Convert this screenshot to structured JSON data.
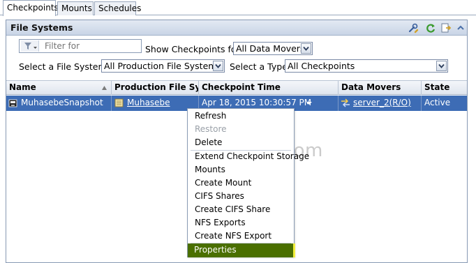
{
  "tabs": [
    "Checkpoints",
    "Mounts",
    "Schedules"
  ],
  "active_tab": "Checkpoints",
  "panel": {
    "title": "File Systems"
  },
  "header_icons": [
    "wrench-icon",
    "refresh-icon",
    "export-icon",
    "collapse-icon"
  ],
  "filter": {
    "placeholder": "Filter for",
    "value": ""
  },
  "show_checkpoints": {
    "label": "Show Checkpoints for",
    "value": "All Data Movers"
  },
  "file_system": {
    "label": "Select a File System",
    "value": "All Production File Systems"
  },
  "type": {
    "label": "Select a Type",
    "value": "All Checkpoints"
  },
  "columns": [
    "Name",
    "Production File Syst...",
    "Checkpoint Time",
    "Data Movers",
    "State"
  ],
  "rows": [
    {
      "name": "MuhasebeSnapshot",
      "production_fs": "Muhasebe",
      "checkpoint_time": "Apr 18, 2015 10:30:57 PM",
      "data_movers": "server_2(R/O)",
      "state": "Active"
    }
  ],
  "context_menu": {
    "items": [
      {
        "label": "Refresh",
        "disabled": false
      },
      {
        "label": "Restore",
        "disabled": true
      },
      {
        "label": "Delete",
        "disabled": false
      },
      {
        "label": "Extend Checkpoint Storage",
        "disabled": false
      },
      {
        "label": "Mounts",
        "disabled": false
      },
      {
        "label": "Create Mount",
        "disabled": false
      },
      {
        "label": "CIFS Shares",
        "disabled": false
      },
      {
        "label": "Create CIFS Share",
        "disabled": false
      },
      {
        "label": "NFS Exports",
        "disabled": false
      },
      {
        "label": "Create NFS Export",
        "disabled": false
      },
      {
        "label": "Properties",
        "disabled": false,
        "highlighted": true
      }
    ]
  },
  "watermark": "geekdabs.com",
  "colors": {
    "selection": "#3d6cb5",
    "highlight": "#4a6f00",
    "highlight_edge": "#f2ef3c"
  }
}
